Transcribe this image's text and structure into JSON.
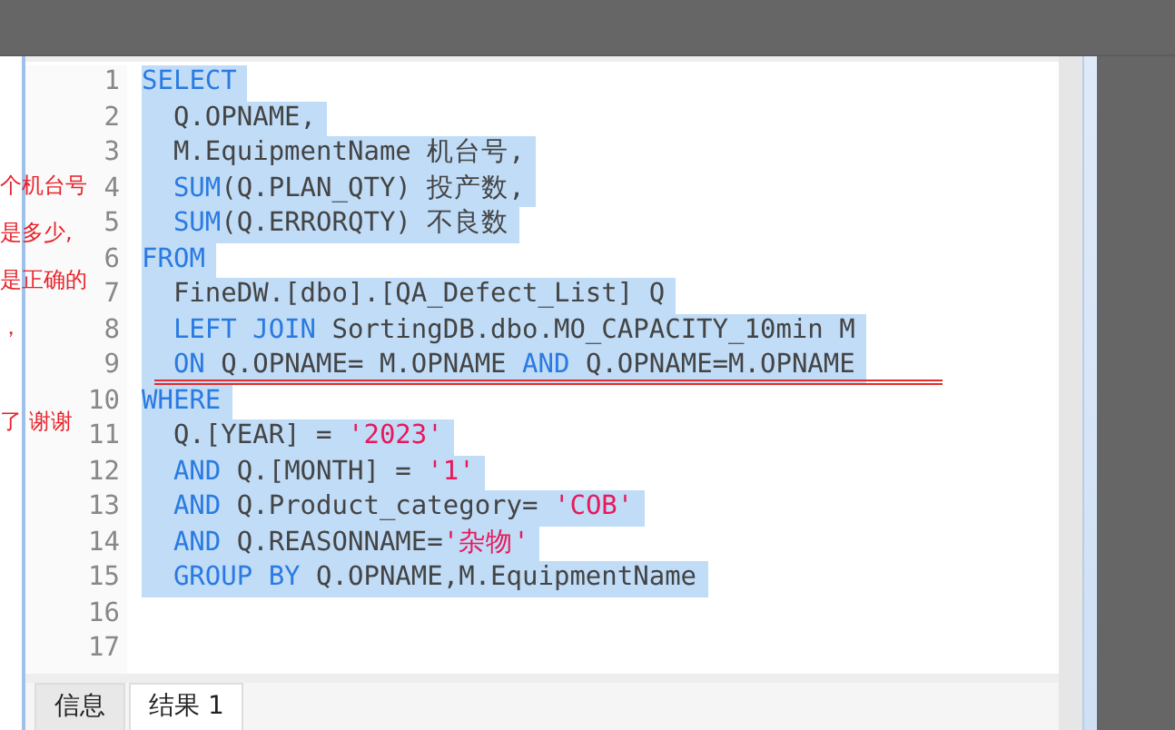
{
  "editor": {
    "lines": [
      {
        "number": "1",
        "selected": true,
        "indented": false,
        "tokens": [
          {
            "kind": "keyword",
            "text": "SELECT"
          }
        ]
      },
      {
        "number": "2",
        "selected": true,
        "indented": true,
        "tokens": [
          {
            "kind": "plain",
            "text": "Q.OPNAME,"
          }
        ]
      },
      {
        "number": "3",
        "selected": true,
        "indented": true,
        "tokens": [
          {
            "kind": "plain",
            "text": "M.EquipmentName 机台号,"
          }
        ]
      },
      {
        "number": "4",
        "selected": true,
        "indented": true,
        "tokens": [
          {
            "kind": "keyword",
            "text": "SUM"
          },
          {
            "kind": "plain",
            "text": "(Q.PLAN_QTY) 投产数,"
          }
        ]
      },
      {
        "number": "5",
        "selected": true,
        "indented": true,
        "tokens": [
          {
            "kind": "keyword",
            "text": "SUM"
          },
          {
            "kind": "plain",
            "text": "(Q.ERRORQTY) 不良数"
          }
        ]
      },
      {
        "number": "6",
        "selected": true,
        "indented": false,
        "tokens": [
          {
            "kind": "keyword",
            "text": "FROM"
          }
        ]
      },
      {
        "number": "7",
        "selected": true,
        "indented": true,
        "tokens": [
          {
            "kind": "plain",
            "text": "FineDW.[dbo].[QA_Defect_List] Q"
          }
        ]
      },
      {
        "number": "8",
        "selected": true,
        "indented": true,
        "tokens": [
          {
            "kind": "keyword",
            "text": "LEFT JOIN"
          },
          {
            "kind": "plain",
            "text": " SortingDB.dbo.MO_CAPACITY_10min M"
          }
        ]
      },
      {
        "number": "9",
        "selected": true,
        "indented": true,
        "tokens": [
          {
            "kind": "keyword",
            "text": "ON"
          },
          {
            "kind": "plain",
            "text": " Q.OPNAME= M.OPNAME "
          },
          {
            "kind": "keyword",
            "text": "AND"
          },
          {
            "kind": "plain",
            "text": " Q.OPNAME=M.OPNAME"
          }
        ]
      },
      {
        "number": "10",
        "selected": true,
        "indented": false,
        "tokens": [
          {
            "kind": "keyword",
            "text": "WHERE"
          }
        ]
      },
      {
        "number": "11",
        "selected": true,
        "indented": true,
        "tokens": [
          {
            "kind": "plain",
            "text": "Q.[YEAR] = "
          },
          {
            "kind": "string",
            "text": "'2023'"
          }
        ]
      },
      {
        "number": "12",
        "selected": true,
        "indented": true,
        "tokens": [
          {
            "kind": "keyword",
            "text": "AND"
          },
          {
            "kind": "plain",
            "text": " Q.[MONTH] = "
          },
          {
            "kind": "string",
            "text": "'1'"
          }
        ]
      },
      {
        "number": "13",
        "selected": true,
        "indented": true,
        "tokens": [
          {
            "kind": "keyword",
            "text": "AND"
          },
          {
            "kind": "plain",
            "text": " Q.Product_category= "
          },
          {
            "kind": "string",
            "text": "'COB'"
          }
        ]
      },
      {
        "number": "14",
        "selected": true,
        "indented": true,
        "tokens": [
          {
            "kind": "keyword",
            "text": "AND"
          },
          {
            "kind": "plain",
            "text": " Q.REASONNAME="
          },
          {
            "kind": "string",
            "text": "'杂物'"
          }
        ]
      },
      {
        "number": "15",
        "selected": true,
        "indented": true,
        "tokens": [
          {
            "kind": "keyword",
            "text": "GROUP BY"
          },
          {
            "kind": "plain",
            "text": " Q.OPNAME,M.EquipmentName"
          }
        ]
      },
      {
        "number": "16"
      },
      {
        "number": "17"
      }
    ]
  },
  "annotation": {
    "lines": [
      "个机台号",
      "是多少,",
      "是正确的",
      "，",
      "了 谢谢"
    ]
  },
  "result_tabs": [
    {
      "label": "信息",
      "selected": false
    },
    {
      "label": "结果 1",
      "selected": true
    }
  ]
}
